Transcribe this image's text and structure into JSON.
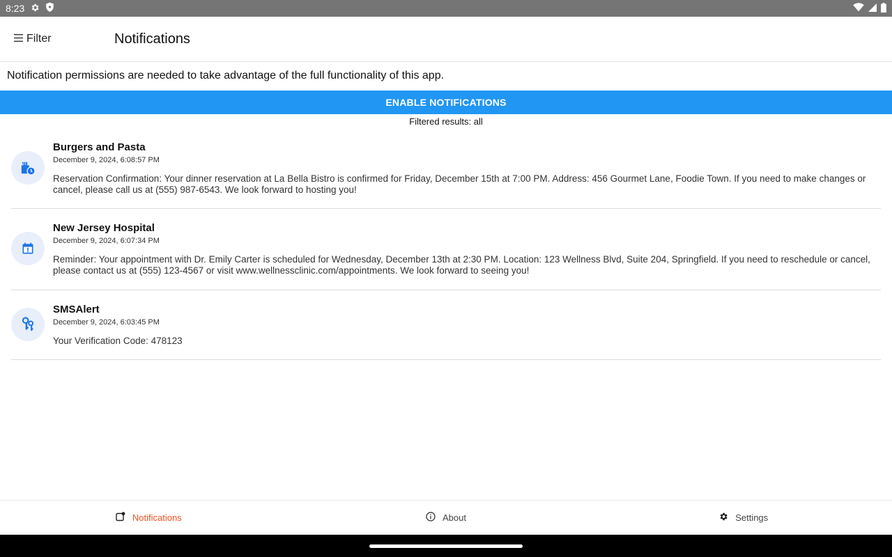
{
  "status_bar": {
    "time": "8:23"
  },
  "app_bar": {
    "filter_label": "Filter",
    "title": "Notifications"
  },
  "permission": {
    "message": "Notification permissions are needed to take advantage of the full functionality of this app.",
    "button_label": "ENABLE NOTIFICATIONS"
  },
  "filter_status": "Filtered results: all",
  "notifications": [
    {
      "title": "Burgers and Pasta",
      "date": "December 9, 2024, 6:08:57 PM",
      "body": "Reservation Confirmation: Your dinner reservation at La Bella Bistro is confirmed for Friday, December 15th at 7:00 PM. Address: 456 Gourmet Lane, Foodie Town. If you need to make changes or cancel, please call us at (555) 987-6543. We look forward to hosting you!",
      "icon": "food-schedule-icon"
    },
    {
      "title": "New Jersey Hospital",
      "date": "December 9, 2024, 6:07:34 PM",
      "body": "Reminder: Your appointment with Dr. Emily Carter is scheduled for Wednesday, December 13th at 2:30 PM. Location: 123 Wellness Blvd, Suite 204, Springfield. If you need to reschedule or cancel, please contact us at (555) 123-4567 or visit www.wellnessclinic.com/appointments. We look forward to seeing you!",
      "icon": "calendar-alert-icon"
    },
    {
      "title": "SMSAlert",
      "date": "December 9, 2024, 6:03:45 PM",
      "body": "Your Verification Code: 478123",
      "icon": "keys-icon"
    }
  ],
  "bottom_nav": {
    "notifications_label": "Notifications",
    "about_label": "About",
    "settings_label": "Settings"
  },
  "colors": {
    "primary_blue": "#2196f3",
    "active_nav": "#f4511e",
    "icon_blue": "#1a73e8",
    "avatar_bg": "#e8effb"
  }
}
